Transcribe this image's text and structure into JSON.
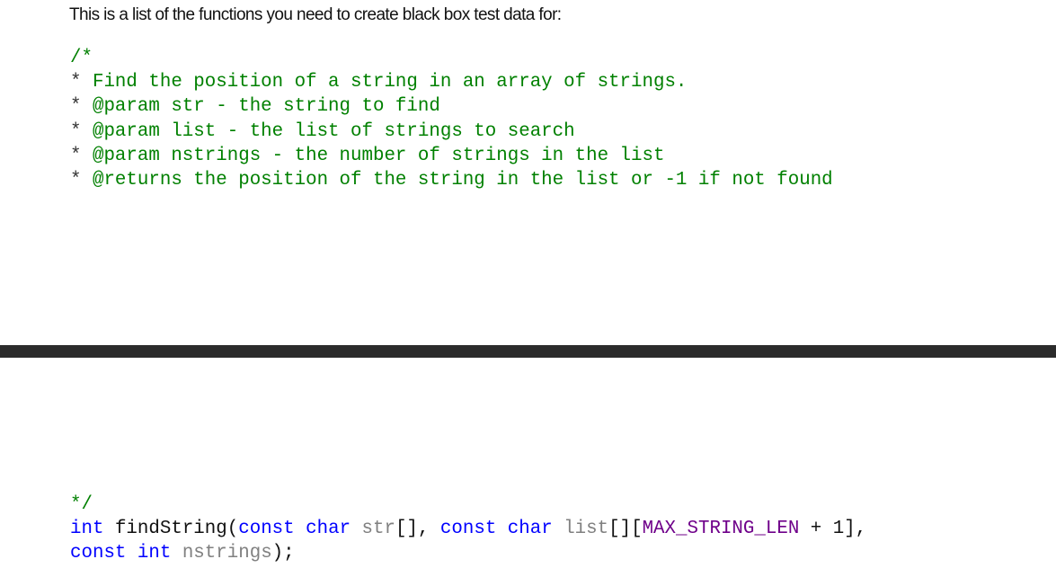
{
  "intro": "This is a list of the functions you need to create black box test data for:",
  "comment": {
    "open": "/*",
    "star": "*",
    "lines": [
      "Find the position of a string in an array of strings.",
      "@param str - the string to find",
      "@param list - the list of strings to search",
      "@param nstrings - the number of strings in the list",
      "@returns the position of the string in the list or -1 if not found"
    ],
    "close": "*/"
  },
  "signature": {
    "ret": "int",
    "name": "findString(",
    "const1": "const",
    "char1": "char",
    "p1": "str",
    "p1suffix": "[], ",
    "const2": "const",
    "char2": "char",
    "p2": "list",
    "p2suffix": "[][",
    "macro": "MAX_STRING_LEN",
    "tail1": " + 1],",
    "const3": "const",
    "int3": "int",
    "p3": "nstrings",
    "end": ");"
  },
  "colors": {
    "comment": "#008000",
    "keyword": "#0000ff",
    "param": "#808080",
    "macro": "#6f008a",
    "divider": "#2b2b2b"
  }
}
